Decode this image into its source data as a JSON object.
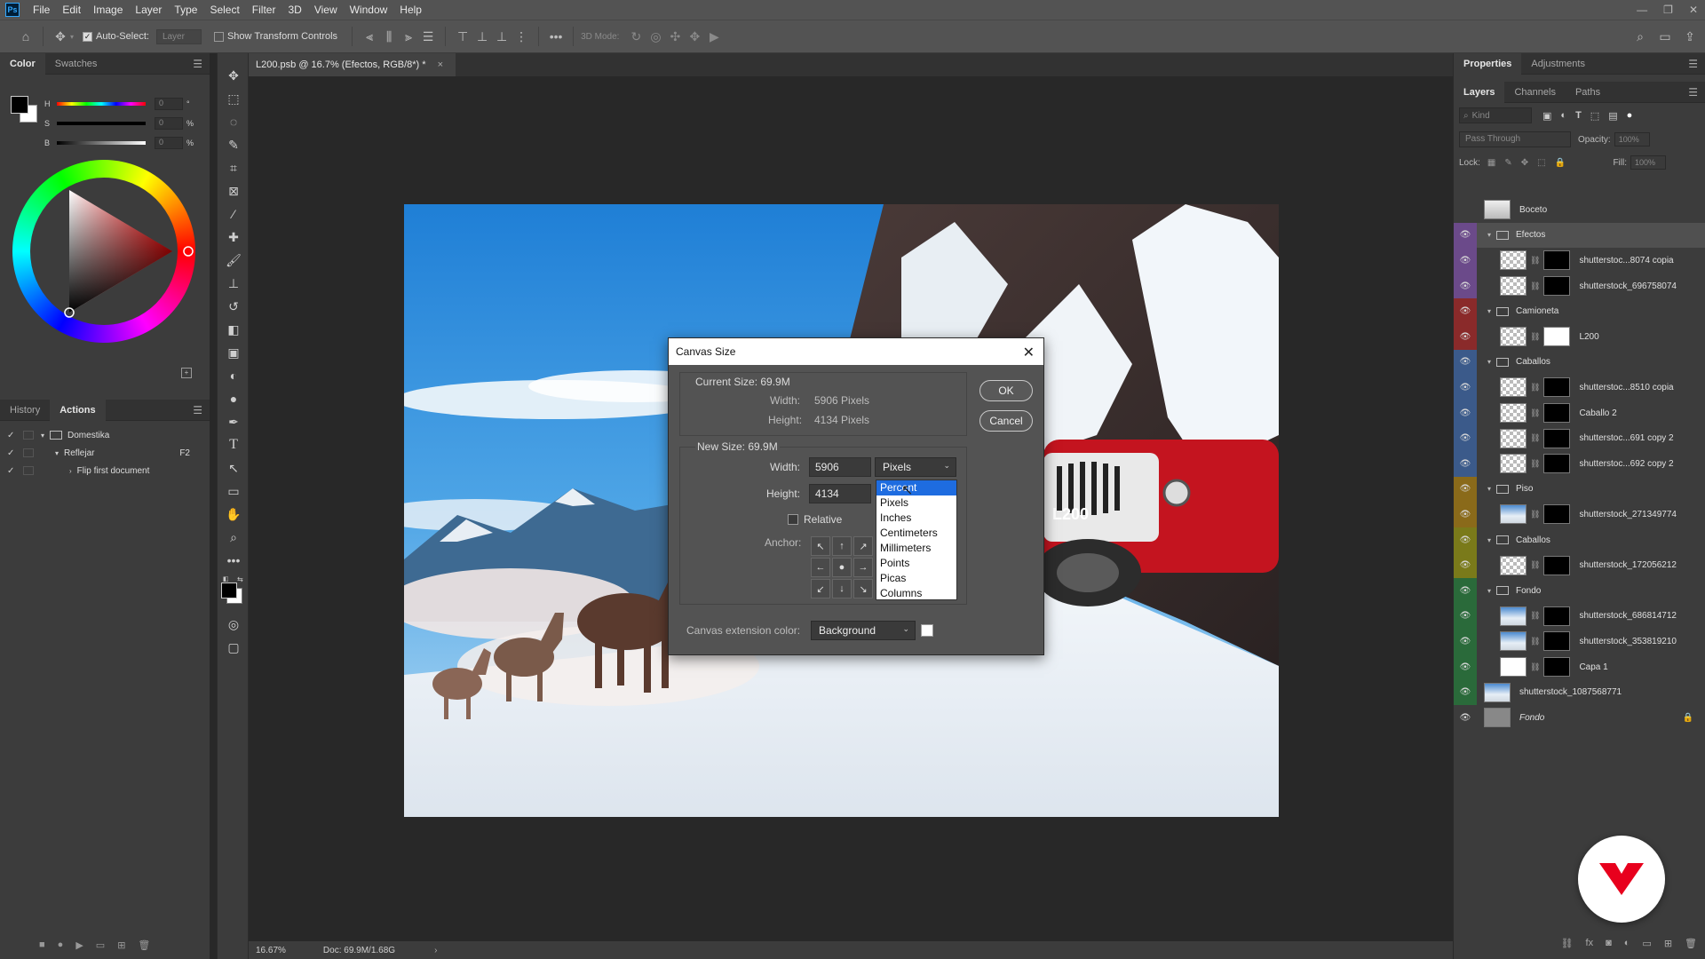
{
  "menubar": {
    "logo": "Ps",
    "items": [
      "File",
      "Edit",
      "Image",
      "Layer",
      "Type",
      "Select",
      "Filter",
      "3D",
      "View",
      "Window",
      "Help"
    ]
  },
  "options": {
    "auto_select_label": "Auto-Select:",
    "auto_select_target": "Layer",
    "show_transform_label": "Show Transform Controls",
    "mode_3d_label": "3D Mode:"
  },
  "color_panel": {
    "tabs": [
      "Color",
      "Swatches"
    ],
    "hsb_labels": [
      "H",
      "S",
      "B"
    ],
    "hsb_values": [
      "0",
      "0",
      "0"
    ],
    "hsb_units": [
      "°",
      "%",
      "%"
    ]
  },
  "history_panel": {
    "tabs": [
      "History",
      "Actions"
    ],
    "rows": [
      {
        "label": "Domestika",
        "shortcut": ""
      },
      {
        "label": "Reflejar",
        "shortcut": "F2"
      },
      {
        "label": "Flip first document",
        "shortcut": ""
      }
    ]
  },
  "document": {
    "tab_title": "L200.psb @ 16.7% (Efectos, RGB/8*) *",
    "tab_close": "×",
    "zoom": "16.67%",
    "doc_info": "Doc: 69.9M/1.68G"
  },
  "dialog": {
    "title": "Canvas Size",
    "current_size_label": "Current Size: 69.9M",
    "current_width_label": "Width:",
    "current_width_value": "5906 Pixels",
    "current_height_label": "Height:",
    "current_height_value": "4134 Pixels",
    "new_size_label": "New Size: 69.9M",
    "width_label": "Width:",
    "width_value": "5906",
    "height_label": "Height:",
    "height_value": "4134",
    "unit_selected": "Pixels",
    "relative_label": "Relative",
    "relative_checked": false,
    "anchor_label": "Anchor:",
    "extension_label": "Canvas extension color:",
    "extension_value": "Background",
    "extension_swatch": "#ffffff",
    "ok_label": "OK",
    "cancel_label": "Cancel",
    "unit_options": [
      "Percent",
      "Pixels",
      "Inches",
      "Centimeters",
      "Millimeters",
      "Points",
      "Picas",
      "Columns"
    ],
    "highlighted_option": "Percent"
  },
  "right_panel": {
    "top_tabs": [
      "Properties",
      "Adjustments"
    ],
    "layer_tabs": [
      "Layers",
      "Channels",
      "Paths"
    ],
    "filter_placeholder": "Kind",
    "blend_mode": "Pass Through",
    "opacity_label": "Opacity:",
    "opacity_value": "100%",
    "lock_label": "Lock:",
    "fill_label": "Fill:",
    "fill_value": "100%"
  },
  "layers": [
    {
      "name": "Boceto",
      "type": "layer",
      "visible": false,
      "color": "",
      "indent": 0,
      "thumb": "sketch",
      "mask": false
    },
    {
      "name": "Efectos",
      "type": "group",
      "visible": true,
      "color": "#6b4a8a",
      "indent": 0,
      "selected": true
    },
    {
      "name": "shutterstoc...8074 copia",
      "type": "layer",
      "visible": true,
      "color": "#6b4a8a",
      "indent": 1,
      "thumb": "checker",
      "mask": "black"
    },
    {
      "name": "shutterstock_696758074",
      "type": "layer",
      "visible": true,
      "color": "#6b4a8a",
      "indent": 1,
      "thumb": "checker",
      "mask": "black"
    },
    {
      "name": "Camioneta",
      "type": "group",
      "visible": true,
      "color": "#8a2a2a",
      "indent": 0
    },
    {
      "name": "L200",
      "type": "layer",
      "visible": true,
      "color": "#8a2a2a",
      "indent": 1,
      "thumb": "checker",
      "mask": "white"
    },
    {
      "name": "Caballos",
      "type": "group",
      "visible": true,
      "color": "#3b5a8a",
      "indent": 0
    },
    {
      "name": "shutterstoc...8510 copia",
      "type": "layer",
      "visible": true,
      "color": "#3b5a8a",
      "indent": 1,
      "thumb": "checker",
      "mask": "black"
    },
    {
      "name": "Caballo 2",
      "type": "layer",
      "visible": true,
      "color": "#3b5a8a",
      "indent": 1,
      "thumb": "checker",
      "mask": "black"
    },
    {
      "name": "shutterstoc...691 copy 2",
      "type": "layer",
      "visible": true,
      "color": "#3b5a8a",
      "indent": 1,
      "thumb": "checker",
      "mask": "black"
    },
    {
      "name": "shutterstoc...692 copy 2",
      "type": "layer",
      "visible": true,
      "color": "#3b5a8a",
      "indent": 1,
      "thumb": "checker",
      "mask": "black"
    },
    {
      "name": "Piso",
      "type": "group",
      "visible": true,
      "color": "#8a6a1a",
      "indent": 0
    },
    {
      "name": "shutterstock_271349774",
      "type": "layer",
      "visible": true,
      "color": "#8a6a1a",
      "indent": 1,
      "thumb": "photo",
      "mask": "black"
    },
    {
      "name": "Caballos",
      "type": "group",
      "visible": true,
      "color": "#7a7a1a",
      "indent": 0
    },
    {
      "name": "shutterstock_172056212",
      "type": "layer",
      "visible": true,
      "color": "#7a7a1a",
      "indent": 1,
      "thumb": "checker",
      "mask": "black"
    },
    {
      "name": "Fondo",
      "type": "group",
      "visible": true,
      "color": "#2a6a3a",
      "indent": 0
    },
    {
      "name": "shutterstock_686814712",
      "type": "layer",
      "visible": true,
      "color": "#2a6a3a",
      "indent": 1,
      "thumb": "photo",
      "mask": "black"
    },
    {
      "name": "shutterstock_353819210",
      "type": "layer",
      "visible": true,
      "color": "#2a6a3a",
      "indent": 1,
      "thumb": "photo",
      "mask": "black"
    },
    {
      "name": "Capa 1",
      "type": "layer",
      "visible": true,
      "color": "#2a6a3a",
      "indent": 1,
      "thumb": "white",
      "mask": "black"
    },
    {
      "name": "shutterstock_1087568771",
      "type": "layer",
      "visible": true,
      "color": "#2a6a3a",
      "indent": 0,
      "thumb": "photo",
      "mask": false
    },
    {
      "name": "Fondo",
      "type": "background",
      "visible": true,
      "color": "",
      "indent": 0,
      "thumb": "gray",
      "mask": false,
      "locked": true
    }
  ]
}
